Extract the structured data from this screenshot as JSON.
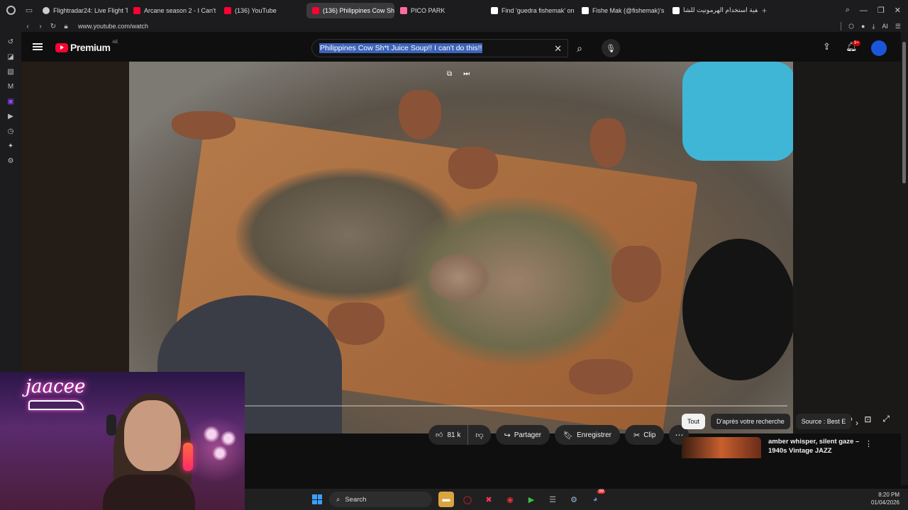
{
  "browser": {
    "tabs": [
      {
        "label": "Flightradar24: Live Flight T",
        "color": "#cccccc",
        "active": false
      },
      {
        "label": "Arcane season 2 - I Can't",
        "color": "#ff0033",
        "active": false
      },
      {
        "label": "(136) YouTube",
        "color": "#ff0033",
        "active": false
      },
      {
        "label": "(136) Philippines Cow Sh",
        "color": "#ff0033",
        "active": true
      },
      {
        "label": "PICO PARK",
        "color": "#ff6b9a",
        "active": false
      },
      {
        "label": "Find 'guedra fishemak' on",
        "color": "#ffffff",
        "active": false
      },
      {
        "label": "Fishe Mak (@fishemak)'s",
        "color": "#ffffff",
        "active": false
      },
      {
        "label": "كيفية استخدام الهرمونيت للشا",
        "color": "#ffffff",
        "active": false
      }
    ],
    "url": "www.youtube.com/watch",
    "ai_label": "AI"
  },
  "youtube": {
    "brand": "Premium",
    "country": "AE",
    "search_query": "Philippines Cow Sh*t Juice Soup!! I can't do this!!",
    "notif_count": "9+",
    "likes": "81 k",
    "share_label": "Partager",
    "save_label": "Enregistrer",
    "clip_label": "Clip",
    "chips": [
      "Tout",
      "D'après votre recherche",
      "Source : Best E"
    ],
    "reco_title": "amber whisper, silent gaze – 1940s Vintage JAZZ"
  },
  "webcam": {
    "name": "jaacee"
  },
  "taskbar": {
    "search_placeholder": "Search",
    "time": "8:20 PM",
    "date": "01/04/2026",
    "discord_badge": "99"
  },
  "icons": {
    "search": "search-icon",
    "mic": "mic-icon",
    "upload": "upload-icon",
    "bell": "bell-icon",
    "like": "thumbs-up-icon",
    "dislike": "thumbs-down-icon",
    "share": "share-icon",
    "save": "bookmark-icon",
    "clip": "scissors-icon"
  },
  "colors": {
    "yt_red": "#ff0033",
    "accent_blue": "#3d63b8",
    "bg": "#0f0f0f"
  }
}
